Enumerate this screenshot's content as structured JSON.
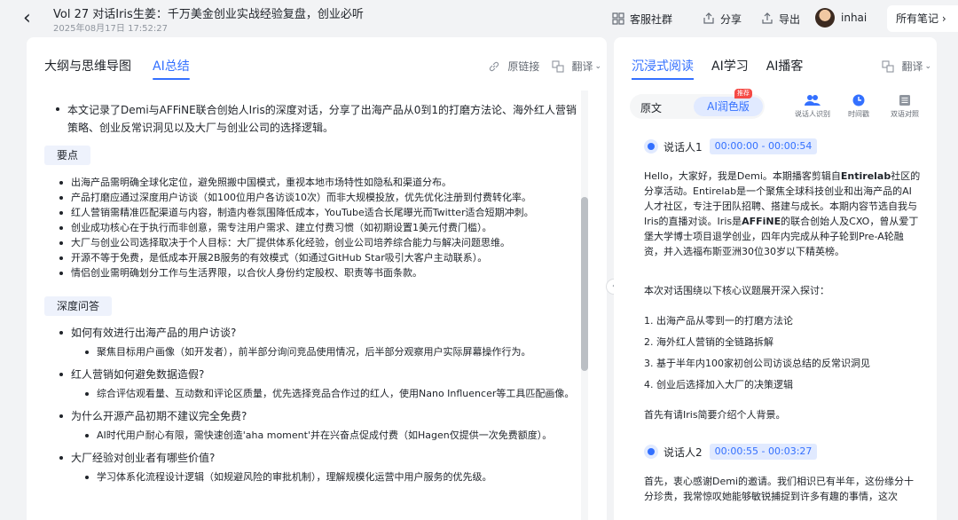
{
  "header": {
    "title": "Vol 27 对话Iris生姜：千万美金创业实战经验复盘，创业必听",
    "date": "2025年08月17日 17:52:27",
    "service_group": "客服社群",
    "share": "分享",
    "export": "导出",
    "username": "inhai",
    "all_notes": "所有笔记"
  },
  "left": {
    "tabs": [
      "大纲与思维导图",
      "AI总结"
    ],
    "active_tab": 1,
    "original_link": "原链接",
    "translate": "翻译",
    "intro": "本文记录了Demi与AFFiNE联合创始人Iris的深度对话，分享了出海产品从0到1的打磨方法论、海外红人营销策略、创业反常识洞见以及大厂与创业公司的选择逻辑。",
    "key_points_title": "要点",
    "key_points": [
      "出海产品需明确全球化定位，避免照搬中国模式，重视本地市场特性如隐私和渠道分布。",
      "产品打磨应通过深度用户访谈（如100位用户各访谈10次）而非大规模投放，优先优化注册到付费转化率。",
      "红人营销需精准匹配渠道与内容，制造内卷氛围降低成本，YouTube适合长尾曝光而Twitter适合短期冲刺。",
      "创业成功核心在于执行而非创意，需专注用户需求、建立付费习惯（如初期设置1美元付费门槛）。",
      "大厂与创业公司选择取决于个人目标：大厂提供体系化经验，创业公司培养综合能力与解决问题思维。",
      "开源不等于免费，是低成本开展2B服务的有效模式（如通过GitHub Star吸引大客户主动联系）。",
      "情侣创业需明确划分工作与生活界限，以合伙人身份约定股权、职责等书面条款。"
    ],
    "qa_title": "深度问答",
    "qa": [
      {
        "q": "如何有效进行出海产品的用户访谈?",
        "a": "聚焦目标用户画像（如开发者），前半部分询问竞品使用情况，后半部分观察用户实际屏幕操作行为。"
      },
      {
        "q": "红人营销如何避免数据造假?",
        "a": "综合评估观看量、互动数和评论区质量，优先选择竞品合作过的红人，使用Nano Influencer等工具匹配画像。"
      },
      {
        "q": "为什么开源产品初期不建议完全免费?",
        "a": "AI时代用户耐心有限，需快速创造'aha moment'并在兴奋点促成付费（如Hagen仅提供一次免费额度）。"
      },
      {
        "q": "大厂经验对创业者有哪些价值?",
        "a": "学习体系化流程设计逻辑（如规避风险的审批机制），理解规模化运营中用户服务的优先级。"
      }
    ]
  },
  "right": {
    "tabs": [
      "沉浸式阅读",
      "AI学习",
      "AI播客"
    ],
    "active_tab": 0,
    "translate": "翻译",
    "seg_original": "原文",
    "seg_ai": "AI润色版",
    "badge": "推荐",
    "icons": [
      {
        "icon": "users-icon",
        "label": "说话人识别"
      },
      {
        "icon": "clock-icon",
        "label": "时间戳"
      },
      {
        "icon": "bilingual-icon",
        "label": "双语对照"
      }
    ],
    "speaker1": "说话人1",
    "time1": "00:00:00 - 00:00:54",
    "p1_a": "Hello，大家好，我是Demi。本期播客剪辑自",
    "p1_b": "Entirelab",
    "p1_c": "社区的分享活动。Entirelab是一个聚焦全球科技创业和出海产品的AI人才社区，专注于团队招聘、搭建与成长。本期内容节选自我与Iris的直播对谈。Iris是",
    "p1_d": "AFFiNE",
    "p1_e": "的联合创始人及CXO，曾从爱丁堡大学博士项目退学创业，四年内完成从种子轮到Pre-A轮融资，并入选福布斯亚洲30位30岁以下精英榜。",
    "p2": "本次对话围绕以下核心议题展开深入探讨：",
    "list": [
      "1. 出海产品从零到一的打磨方法论",
      "2. 海外红人营销的全链路拆解",
      "3. 基于半年内100家初创公司访谈总结的反常识洞见",
      "4. 创业后选择加入大厂的决策逻辑"
    ],
    "p3": "首先有请Iris简要介绍个人背景。",
    "speaker2": "说话人2",
    "time2": "00:00:55 - 00:03:27",
    "p4": "首先，衷心感谢Demi的邀请。我们相识已有半年，这份缘分十分珍贵，我常惊叹她能够敏锐捕捉到许多有趣的事情，这次"
  }
}
